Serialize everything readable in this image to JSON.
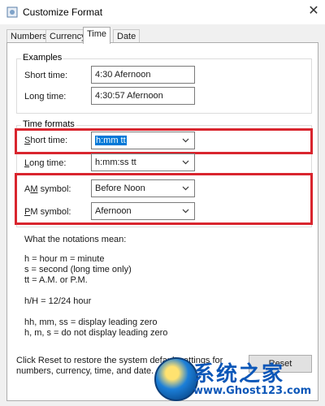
{
  "window": {
    "title": "Customize Format",
    "close_glyph": "✕"
  },
  "tabs": [
    {
      "label": "Numbers",
      "active": false
    },
    {
      "label": "Currency",
      "active": false
    },
    {
      "label": "Time",
      "active": true
    },
    {
      "label": "Date",
      "active": false
    }
  ],
  "examples": {
    "legend": "Examples",
    "short_label": "Short time:",
    "short_value": "4:30 Afernoon",
    "long_label": "Long time:",
    "long_value": "4:30:57 Afernoon"
  },
  "formats": {
    "legend": "Time formats",
    "short_label_mnemonic": "S",
    "short_label_rest": "hort time:",
    "short_value": "h:mm tt",
    "long_label_mnemonic": "L",
    "long_label_rest": "ong time:",
    "long_value": "h:mm:ss tt",
    "am_label_pre": "A",
    "am_label_mnemonic": "M",
    "am_label_rest": " symbol:",
    "am_value": "Before Noon",
    "pm_label_mnemonic": "P",
    "pm_label_rest": "M symbol:",
    "pm_value": "Afernoon"
  },
  "notations": {
    "heading": "What the notations mean:",
    "lines": [
      "h = hour   m = minute",
      "s = second (long time only)",
      "tt = A.M. or P.M.",
      "h/H = 12/24 hour",
      "hh, mm, ss = display leading zero",
      "h, m, s = do not display leading zero"
    ]
  },
  "footer": {
    "reset_text_line1": "Click Reset to restore the system default settings for",
    "reset_text_line2": "numbers, currency, time, and date.",
    "reset_button": "Reset"
  },
  "watermark": {
    "text": "系统之家",
    "url": "www.Ghost123.com"
  },
  "colors": {
    "highlight": "#d9252e",
    "selection": "#0078d7"
  },
  "icons": {
    "app": "gear-document-icon",
    "dropdown": "chevron-down-icon",
    "close": "close-icon"
  }
}
